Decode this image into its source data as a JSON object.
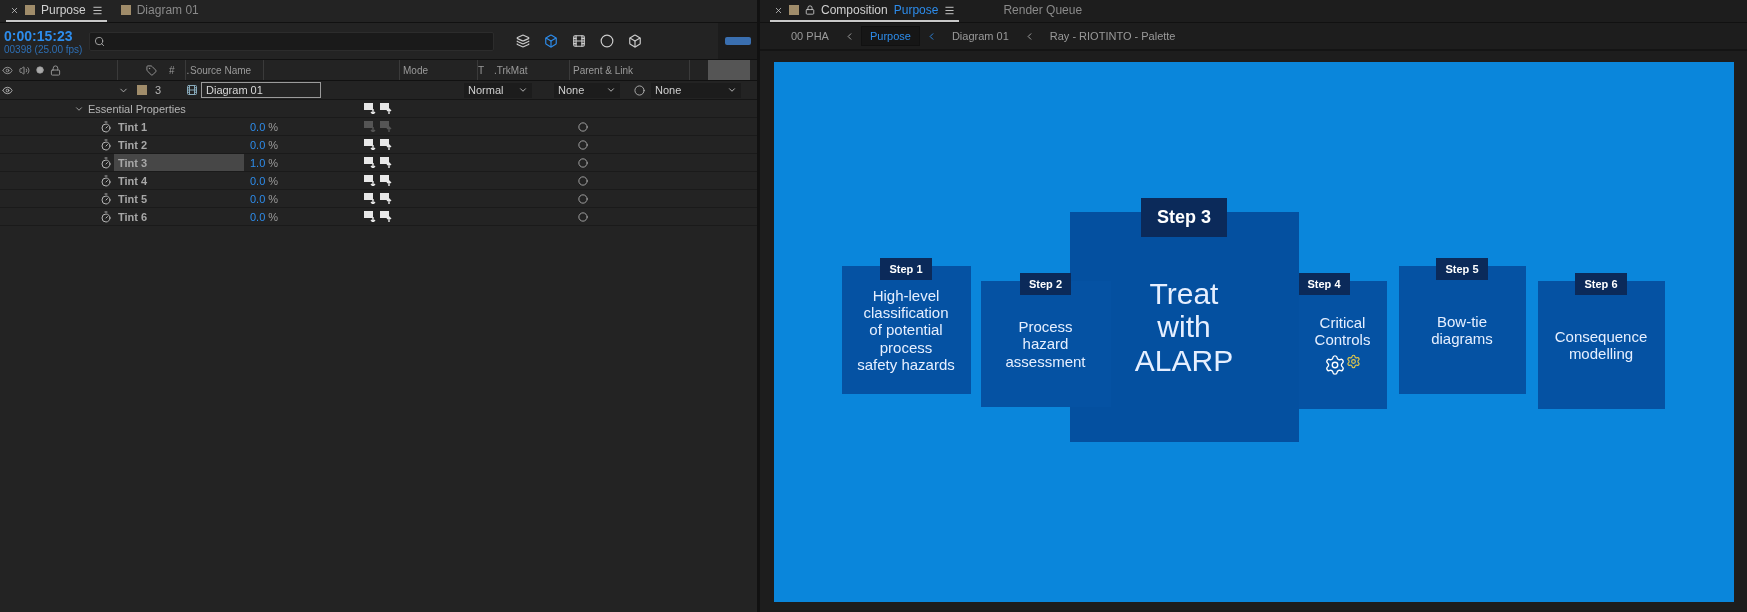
{
  "timeline_panel": {
    "tabs": [
      {
        "label": "Purpose",
        "selected": true
      },
      {
        "label": "Diagram 01",
        "selected": false
      }
    ],
    "timecode": "0:00:15:23",
    "frame_info": "00398 (25.00 fps)",
    "columns": {
      "number": "#",
      "dot": ".",
      "source_name": "Source Name",
      "mode": "Mode",
      "t": "T",
      "trkmat": ".TrkMat",
      "parent": "Parent & Link"
    },
    "layer": {
      "number": "3",
      "source_name": "Diagram 01",
      "mode": "Normal",
      "trkmat": "None",
      "parent": "None",
      "expanded": true
    },
    "group": {
      "label": "Essential Properties",
      "expanded": true
    },
    "properties": [
      {
        "name": "Tint 1",
        "value": "0.0",
        "unit": "%",
        "selected": false,
        "keyframes_enabled": false
      },
      {
        "name": "Tint 2",
        "value": "0.0",
        "unit": "%",
        "selected": false,
        "keyframes_enabled": true
      },
      {
        "name": "Tint 3",
        "value": "1.0",
        "unit": "%",
        "selected": true,
        "keyframes_enabled": true
      },
      {
        "name": "Tint 4",
        "value": "0.0",
        "unit": "%",
        "selected": false,
        "keyframes_enabled": true
      },
      {
        "name": "Tint 5",
        "value": "0.0",
        "unit": "%",
        "selected": false,
        "keyframes_enabled": true
      },
      {
        "name": "Tint 6",
        "value": "0.0",
        "unit": "%",
        "selected": false,
        "keyframes_enabled": true
      }
    ]
  },
  "composition_panel": {
    "tabs": [
      {
        "label": "Composition",
        "comp": "Purpose",
        "selected": true
      },
      {
        "label": "Render Queue",
        "selected": false
      }
    ],
    "breadcrumbs": [
      {
        "label": "00 PHA",
        "selected": false
      },
      {
        "label": "Purpose",
        "selected": true
      },
      {
        "label": "Diagram 01",
        "selected": false
      },
      {
        "label": "Ray - RIOTINTO - Palette",
        "selected": false
      }
    ],
    "steps": [
      {
        "label": "Step 1",
        "text": "High-level\nclassification\nof potential\nprocess\nsafety hazards",
        "kind": "normal"
      },
      {
        "label": "Step 2",
        "text": "Process\nhazard\nassessment",
        "kind": "normal"
      },
      {
        "label": "Step 3",
        "text": "Treat\nwith\nALARP",
        "kind": "featured"
      },
      {
        "label": "Step 4",
        "text": "Critical\nControls",
        "kind": "gears"
      },
      {
        "label": "Step 5",
        "text": "Bow-tie\ndiagrams",
        "kind": "normal"
      },
      {
        "label": "Step 6",
        "text": "Consequence\nmodelling",
        "kind": "normal"
      }
    ]
  }
}
